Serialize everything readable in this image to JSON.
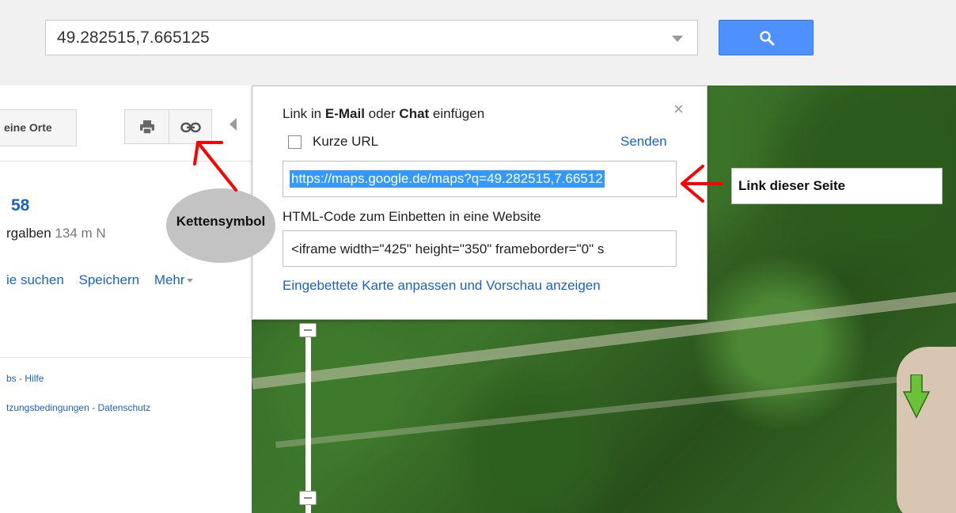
{
  "search": {
    "value": "49.282515,7.665125"
  },
  "sidebar": {
    "orte_label": "eine Orte",
    "place_number": "58",
    "place_name": "rgalben",
    "place_distance": "134 m N",
    "actions": {
      "suchen": "ie suchen",
      "speichern": "Speichern",
      "mehr": "Mehr"
    },
    "footer": {
      "line1_a": "bs",
      "line1_sep": " - ",
      "line1_b": "Hilfe",
      "line2_a": "tzungsbedingungen",
      "line2_sep": " - ",
      "line2_b": "Datenschutz"
    }
  },
  "popup": {
    "title_parts": {
      "p1": "Link in ",
      "p2": "E-Mail",
      "p3": " oder ",
      "p4": "Chat",
      "p5": " einfügen"
    },
    "close": "×",
    "short_url_label": "Kurze URL",
    "send_label": "Senden",
    "url_value": "https://maps.google.de/maps?q=49.282515,7.66512",
    "embed_label": "HTML-Code zum Einbetten in eine Website",
    "embed_value": "<iframe width=\"425\" height=\"350\" frameborder=\"0\" s",
    "embed_link": "Eingebettete Karte anpassen und Vorschau anzeigen"
  },
  "annotations": {
    "ellipse_label": "Kettensymbol",
    "link_label": "Link dieser Seite",
    "arrow_color": "#ff0000"
  },
  "icons": {
    "search": "search-icon",
    "print": "printer-icon",
    "link": "link-chain-icon",
    "collapse": "collapse-left-icon",
    "close": "close-icon",
    "marker": "green-arrow-marker-icon"
  }
}
